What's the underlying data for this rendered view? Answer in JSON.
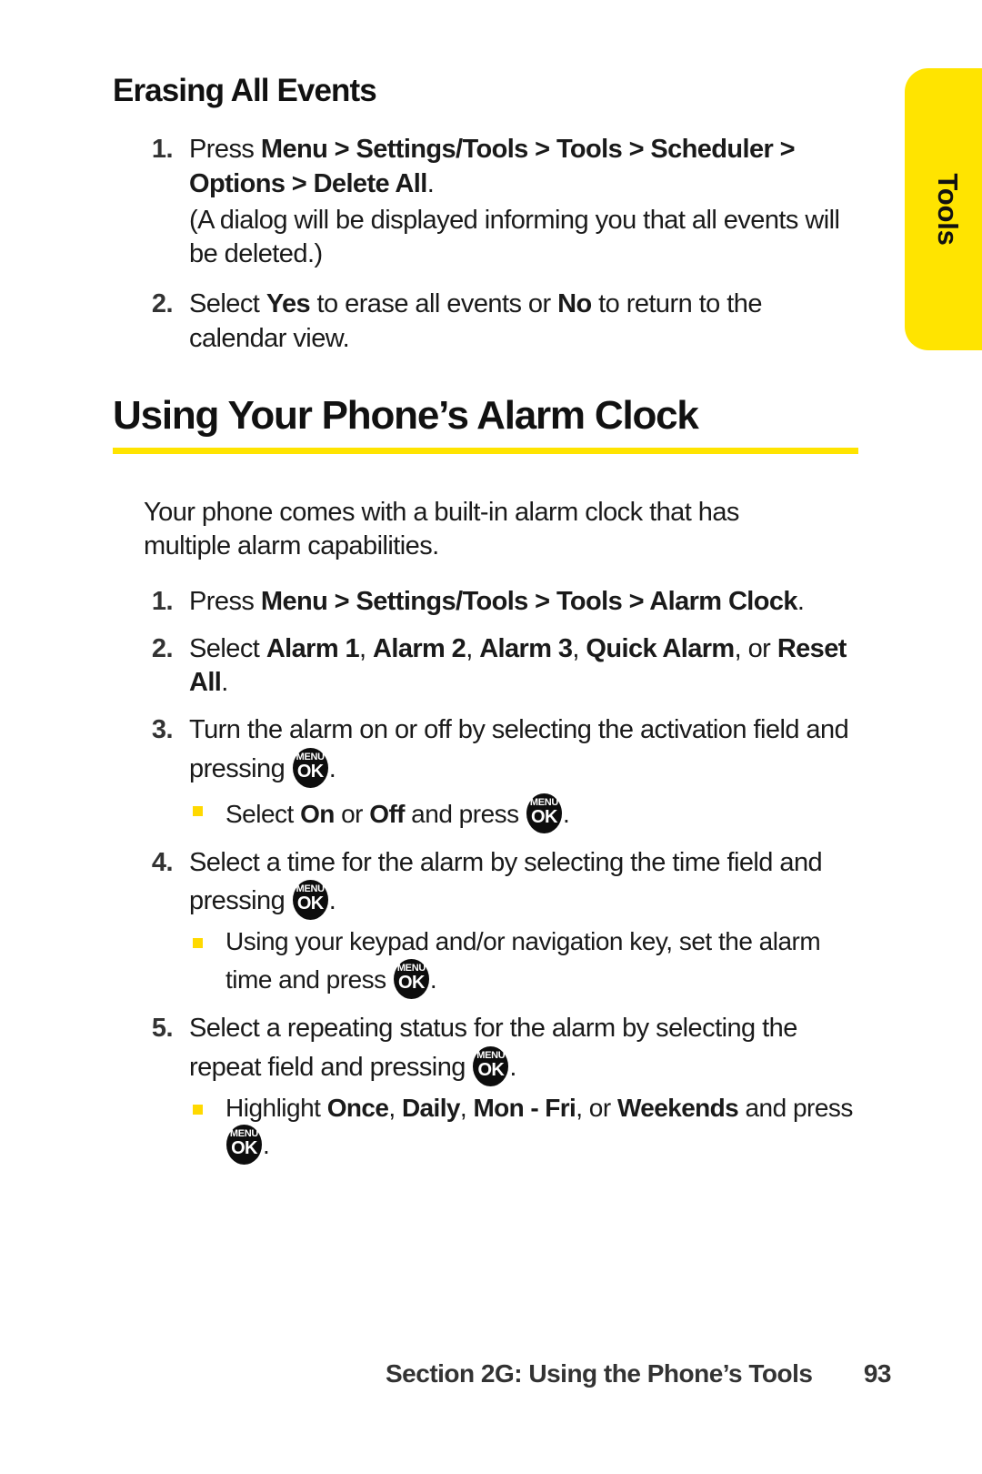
{
  "thumb_tab": {
    "label": "Tools",
    "color": "#ffe400"
  },
  "colors": {
    "accent_yellow": "#ffe400",
    "bullet_yellow": "#ffd900",
    "text": "#1a1a1a"
  },
  "section_erasing": {
    "heading": "Erasing All Events",
    "steps": [
      {
        "num": "1.",
        "lead": "Press ",
        "bold1": "Menu > Settings/Tools > Tools > Scheduler > Options > Delete All",
        "tail": ".",
        "note": "(A dialog will be displayed informing you that all events will be deleted.)"
      },
      {
        "num": "2.",
        "p1": "Select ",
        "b1": "Yes",
        "p2": " to erase all events or ",
        "b2": "No",
        "p3": " to return to the calendar view."
      }
    ]
  },
  "section_alarm": {
    "heading": "Using Your Phone’s Alarm Clock",
    "intro": "Your phone comes with a built-in alarm clock that has multiple alarm capabilities.",
    "steps": [
      {
        "num": "1.",
        "p1": "Press ",
        "b1": "Menu > Settings/Tools > Tools > Alarm Clock",
        "p2": "."
      },
      {
        "num": "2.",
        "p1": "Select ",
        "b1": "Alarm 1",
        "p2": ", ",
        "b2": "Alarm 2",
        "p3": ", ",
        "b3": "Alarm 3",
        "p4": ", ",
        "b4": "Quick Alarm",
        "p5": ", or ",
        "b5": "Reset All",
        "p6": "."
      },
      {
        "num": "3.",
        "p1": "Turn the alarm on or off by selecting the activation field and pressing ",
        "p2": ".",
        "bullets": [
          {
            "p1": "Select ",
            "b1": "On",
            "p2": " or ",
            "b2": "Off",
            "p3": " and press ",
            "p4": "."
          }
        ]
      },
      {
        "num": "4.",
        "p1": "Select a time for the alarm by selecting the time field and pressing ",
        "p2": ".",
        "bullets": [
          {
            "p1": "Using your keypad and/or navigation key, set the alarm time and press ",
            "p4": "."
          }
        ]
      },
      {
        "num": "5.",
        "p1": "Select a repeating status for the alarm by selecting the repeat field and pressing ",
        "p2": ".",
        "bullets": [
          {
            "p1": "Highlight ",
            "b1": "Once",
            "p2": ", ",
            "b2": "Daily",
            "p3": ", ",
            "b3": "Mon - Fri",
            "p4": ", or ",
            "b4": "Weekends",
            "p5": " and press ",
            "p6": "."
          }
        ]
      }
    ]
  },
  "key_glyph": {
    "top_label": "MENU",
    "bottom_label": "OK"
  },
  "footer": {
    "section_text": "Section 2G: Using the Phone’s Tools",
    "page_number": "93"
  }
}
